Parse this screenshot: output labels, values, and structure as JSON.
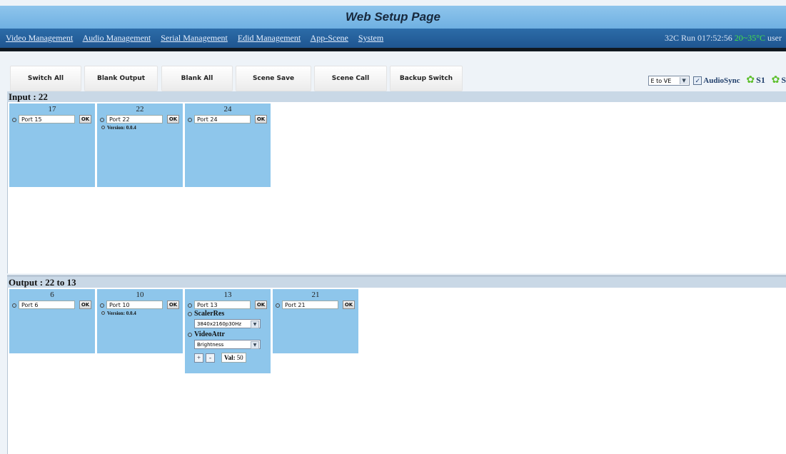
{
  "app": {
    "title": "Web Setup Page"
  },
  "nav": {
    "items": [
      "Video Management",
      "Audio Management",
      "Serial Management",
      "Edid Management",
      "App-Scene",
      "System"
    ],
    "status_prefix": "32C  Run 017:52:56",
    "status_temp": "20~35°C",
    "status_user": "user"
  },
  "toolbar": {
    "buttons": [
      "Switch All",
      "Blank Output",
      "Blank All",
      "Scene Save",
      "Scene Call",
      "Backup Switch"
    ],
    "mode_select": "E to VE",
    "audio_sync_label": "AudioSync",
    "audio_sync_checked": true,
    "s1_label": "S1",
    "s2_label": "S"
  },
  "input": {
    "heading": "Input : 22",
    "cards": [
      {
        "num": "17",
        "port": "Port 15",
        "ok": "OK"
      },
      {
        "num": "22",
        "port": "Port 22",
        "ok": "OK",
        "version": "Version: 0.0.4"
      },
      {
        "num": "24",
        "port": "Port 24",
        "ok": "OK"
      }
    ]
  },
  "output": {
    "heading": "Output : 22 to 13",
    "cards": [
      {
        "num": "6",
        "port": "Port 6",
        "ok": "OK"
      },
      {
        "num": "10",
        "port": "Port 10",
        "ok": "OK",
        "version": "Version: 0.0.4"
      },
      {
        "num": "13",
        "port": "Port 13",
        "ok": "OK",
        "scaler_label": "ScalerRes",
        "scaler_value": "3840x2160p30Hz",
        "video_label": "VideoAttr",
        "video_value": "Brightness",
        "plus": "+",
        "minus": "-",
        "val_label": "Val:",
        "val": "50"
      },
      {
        "num": "21",
        "port": "Port 21",
        "ok": "OK"
      }
    ]
  },
  "colors": {
    "title_bar": "#7fbbe8",
    "nav_bar": "#2561a0",
    "card": "#8ec6eb",
    "status_temp": "#45e24a",
    "section_header": "#c9d8e6"
  },
  "icons": {
    "gear": "gear-icon",
    "dropdown": "chevron-down-icon"
  }
}
